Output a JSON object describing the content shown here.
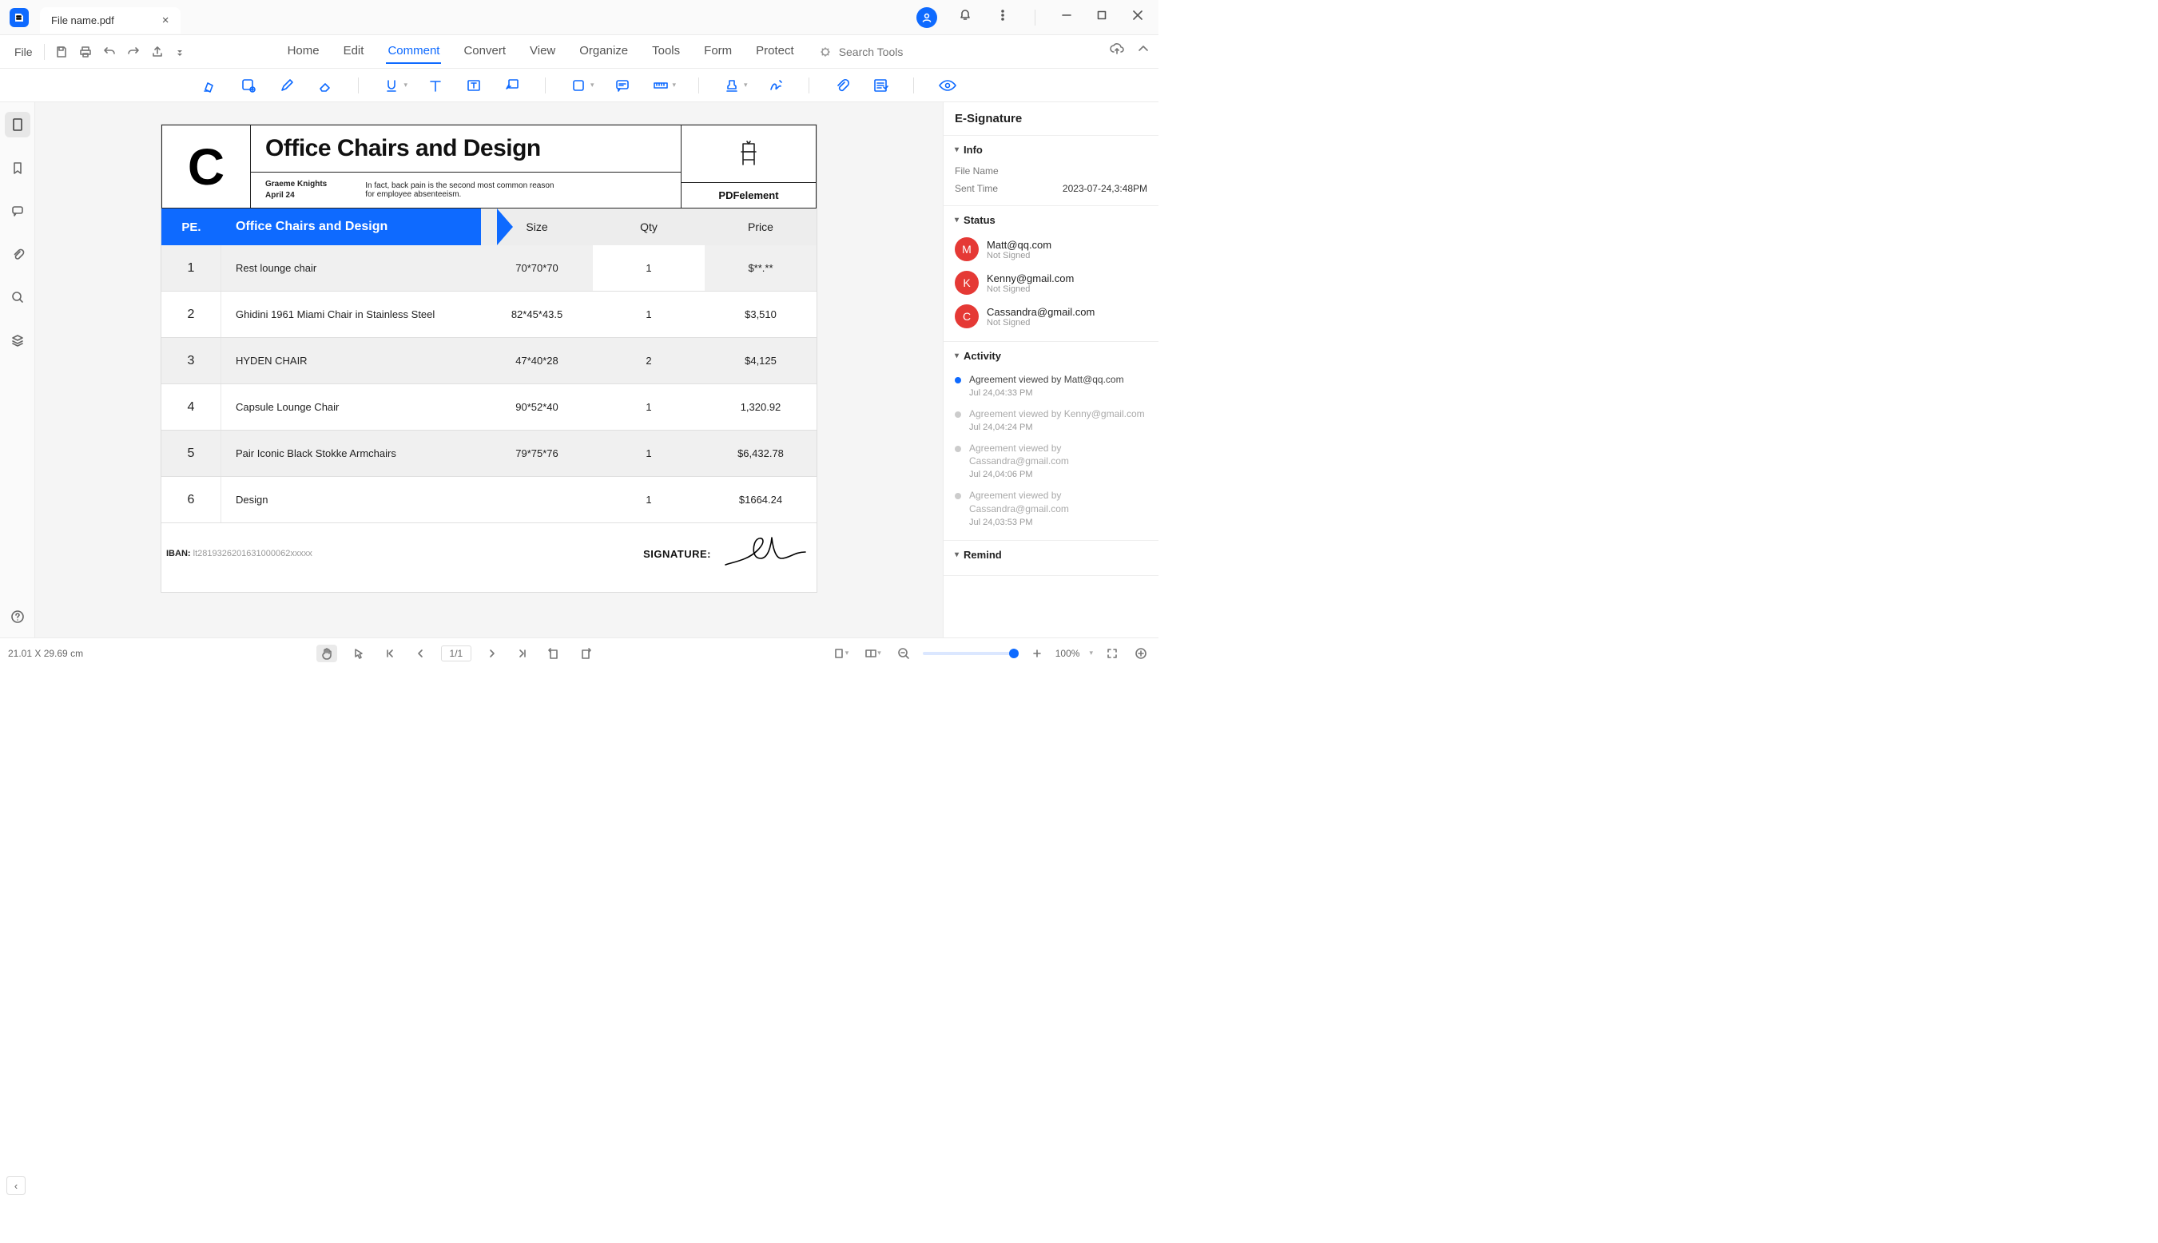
{
  "titlebar": {
    "tab_name": "File name.pdf"
  },
  "menubar": {
    "file": "File",
    "items": [
      "Home",
      "Edit",
      "Comment",
      "Convert",
      "View",
      "Organize",
      "Tools",
      "Form",
      "Protect"
    ],
    "search_placeholder": "Search Tools"
  },
  "document": {
    "title": "Office Chairs and Design",
    "author": "Graeme Knights",
    "date": "April 24",
    "subtitle": "In fact, back pain is the second most common reason for employee absenteeism.",
    "brand": "PDFelement",
    "table": {
      "head_pe": "PE.",
      "head_name": "Office Chairs and Design",
      "cols": [
        "Size",
        "Qty",
        "Price"
      ],
      "rows": [
        {
          "idx": "1",
          "name": "Rest lounge chair",
          "size": "70*70*70",
          "qty": "1",
          "price": "$**.**"
        },
        {
          "idx": "2",
          "name": "Ghidini 1961 Miami Chair in Stainless Steel",
          "size": "82*45*43.5",
          "qty": "1",
          "price": "$3,510"
        },
        {
          "idx": "3",
          "name": "HYDEN CHAIR",
          "size": "47*40*28",
          "qty": "2",
          "price": "$4,125"
        },
        {
          "idx": "4",
          "name": "Capsule Lounge Chair",
          "size": "90*52*40",
          "qty": "1",
          "price": "1,320.92"
        },
        {
          "idx": "5",
          "name": "Pair Iconic Black Stokke Armchairs",
          "size": "79*75*76",
          "qty": "1",
          "price": "$6,432.78"
        },
        {
          "idx": "6",
          "name": "Design",
          "size": "",
          "qty": "1",
          "price": "$1664.24"
        }
      ]
    },
    "iban_label": "IBAN:",
    "iban": "lt2819326201631000062xxxxx",
    "signature_label": "SIGNATURE:"
  },
  "panel": {
    "title": "E-Signature",
    "info_title": "Info",
    "file_name_label": "File Name",
    "file_name_value": "",
    "sent_time_label": "Sent Time",
    "sent_time_value": "2023-07-24,3:48PM",
    "status_title": "Status",
    "signers": [
      {
        "initial": "M",
        "email": "Matt@qq.com",
        "status": "Not Signed"
      },
      {
        "initial": "K",
        "email": "Kenny@gmail.com",
        "status": "Not Signed"
      },
      {
        "initial": "C",
        "email": "Cassandra@gmail.com",
        "status": "Not Signed"
      }
    ],
    "activity_title": "Activity",
    "activity": [
      {
        "text": "Agreement viewed by Matt@qq.com",
        "time": "Jul 24,04:33 PM",
        "current": true
      },
      {
        "text": "Agreement viewed by Kenny@gmail.com",
        "time": "Jul 24,04:24 PM",
        "current": false
      },
      {
        "text": "Agreement viewed by Cassandra@gmail.com",
        "time": "Jul 24,04:06 PM",
        "current": false
      },
      {
        "text": "Agreement viewed by Cassandra@gmail.com",
        "time": "Jul 24,03:53 PM",
        "current": false
      }
    ],
    "remind_title": "Remind"
  },
  "statusbar": {
    "dimensions": "21.01 X 29.69 cm",
    "page": "1/1",
    "zoom": "100%"
  }
}
